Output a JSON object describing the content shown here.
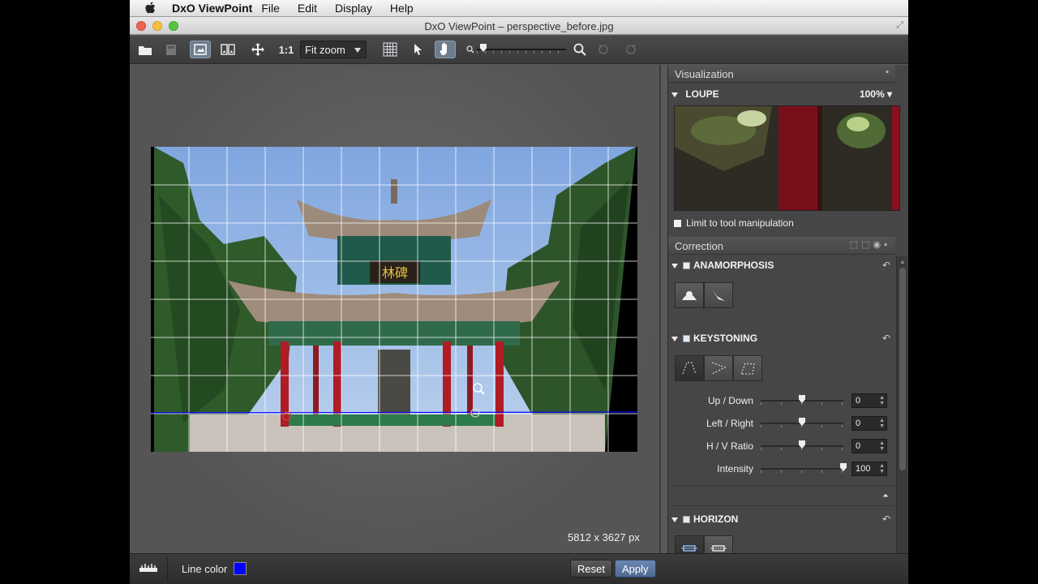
{
  "menubar": {
    "app_name": "DxO ViewPoint",
    "items": [
      "File",
      "Edit",
      "Display",
      "Help"
    ]
  },
  "window": {
    "title": "DxO ViewPoint – perspective_before.jpg"
  },
  "toolbar": {
    "one_to_one": "1:1",
    "zoom_mode": "Fit zoom"
  },
  "canvas": {
    "image_size": "5812 x 3627 px",
    "grid_line_color": "#0000ff"
  },
  "bottom": {
    "line_color_label": "Line color",
    "reset_label": "Reset",
    "apply_label": "Apply"
  },
  "panel": {
    "visualization_header": "Visualization",
    "loupe_label": "LOUPE",
    "loupe_zoom": "100%",
    "limit_label": "Limit to tool manipulation",
    "correction_header": "Correction",
    "anamorphosis_label": "ANAMORPHOSIS",
    "keystoning_label": "KEYSTONING",
    "horizon_label": "HORIZON",
    "sliders": [
      {
        "label": "Up / Down",
        "value": "0"
      },
      {
        "label": "Left / Right",
        "value": "0"
      },
      {
        "label": "H / V Ratio",
        "value": "0"
      },
      {
        "label": "Intensity",
        "value": "100"
      }
    ]
  },
  "colors": {
    "accent": "#4c6a93",
    "line_color": "#0000ff"
  }
}
